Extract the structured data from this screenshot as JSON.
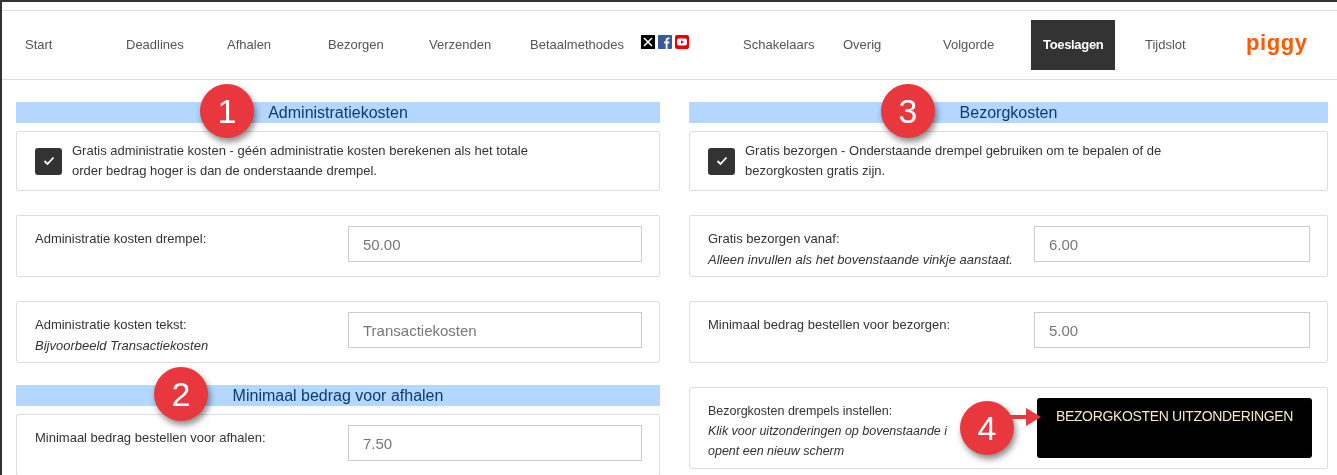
{
  "nav": {
    "items": [
      {
        "kind": "link",
        "label": "Start",
        "selected": false
      },
      {
        "kind": "link",
        "label": "Deadlines",
        "selected": false
      },
      {
        "kind": "link",
        "label": "Afhalen",
        "selected": false
      },
      {
        "kind": "link",
        "label": "Bezorgen",
        "selected": false
      },
      {
        "kind": "link",
        "label": "Verzenden",
        "selected": false
      },
      {
        "kind": "link",
        "label": "Betaalmethodes",
        "selected": false
      },
      {
        "kind": "social"
      },
      {
        "kind": "link",
        "label": "Schakelaars",
        "selected": false
      },
      {
        "kind": "link",
        "label": "Overig",
        "selected": false
      },
      {
        "kind": "link",
        "label": "Volgorde",
        "selected": false
      },
      {
        "kind": "link",
        "label": "Toeslagen",
        "selected": true
      },
      {
        "kind": "link",
        "label": "Tijdslot",
        "selected": false
      },
      {
        "kind": "logo",
        "label": "piggy"
      }
    ]
  },
  "columns": [
    {
      "blocks": [
        {
          "kind": "header",
          "title": "Administratiekosten",
          "badge": "1"
        },
        {
          "kind": "checkbox",
          "checked": true,
          "text": "Gratis administratie kosten - géén administratie kosten berekenen als het totale order bedrag hoger is dan de onderstaande drempel."
        },
        {
          "kind": "field",
          "label": "Administratie kosten drempel:",
          "value": "50.00"
        },
        {
          "kind": "field",
          "label": "Administratie kosten tekst:",
          "hint": "Bijvoorbeeld Transactiekosten",
          "placeholder": "Transactiekosten"
        },
        {
          "kind": "header",
          "title": "Minimaal bedrag voor afhalen",
          "badge": "2"
        },
        {
          "kind": "field",
          "label": "Minimaal bedrag bestellen voor afhalen:",
          "value": "7.50"
        }
      ]
    },
    {
      "blocks": [
        {
          "kind": "header",
          "title": "Bezorgkosten",
          "badge": "3"
        },
        {
          "kind": "checkbox",
          "checked": true,
          "text": "Gratis bezorgen - Onderstaande drempel gebruiken om te bepalen of de bezorgkosten gratis zijn."
        },
        {
          "kind": "field",
          "label": "Gratis bezorgen vanaf:",
          "hint": "Alleen invullen als het bovenstaande vinkje aanstaat.",
          "value": "6.00"
        },
        {
          "kind": "field",
          "label": "Minimaal bedrag bestellen voor bezorgen:",
          "value": "5.00"
        },
        {
          "kind": "button",
          "label": "Bezorgkosten drempels instellen:",
          "hint": "Klik voor uitzonderingen op bovenstaande i",
          "hint2": "opent een nieuw scherm",
          "button": "BEZORGKOSTEN UITZONDERINGEN",
          "badge": "4"
        }
      ]
    }
  ]
}
